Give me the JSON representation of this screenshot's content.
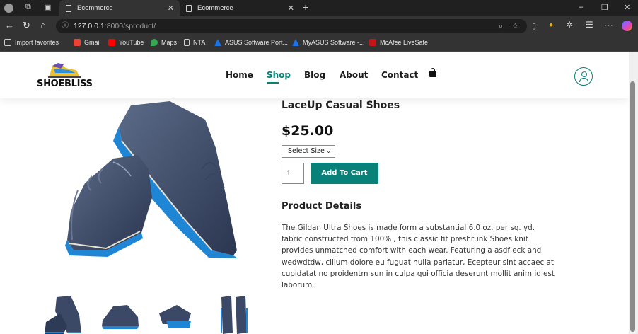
{
  "browser": {
    "tabs": [
      {
        "label": "Ecommerce"
      },
      {
        "label": "Ecommerce"
      }
    ],
    "url_host": "127.0.0.1",
    "url_rest": ":8000/sproduct/",
    "bookmarks": [
      {
        "label": "Import favorites",
        "color": "#cfcfcf"
      },
      {
        "label": "Gmail",
        "color": "#ea4335"
      },
      {
        "label": "YouTube",
        "color": "#ff0000"
      },
      {
        "label": "Maps",
        "color": "#34a853"
      },
      {
        "label": "NTA",
        "color": "#cfcfcf"
      },
      {
        "label": "ASUS Software Port...",
        "color": "#1a73e8"
      },
      {
        "label": "MyASUS Software -...",
        "color": "#1a73e8"
      },
      {
        "label": "McAfee LiveSafe",
        "color": "#c01818"
      }
    ]
  },
  "site": {
    "logo": "SHOEBLISS",
    "nav": [
      {
        "label": "Home"
      },
      {
        "label": "Shop"
      },
      {
        "label": "Blog"
      },
      {
        "label": "About"
      },
      {
        "label": "Contact"
      }
    ],
    "accent": "#088178"
  },
  "product": {
    "title": "LaceUp Casual Shoes",
    "price": "$25.00",
    "size_select": "Select Size",
    "quantity": "1",
    "add_to_cart": "Add To Cart",
    "details_heading": "Product Details",
    "description": "The Gildan Ultra Shoes is made form a substantial 6.0 oz. per sq. yd. fabric constructed from 100% , this classic fit preshrunk Shoes knit provides unmatched comfort with each wear. Featuring a asdf eck and wedwdtdw, cillum dolore eu fuguat nulla pariatur, Ecepteur sint accaec at cupidatat no proidentm sun in culpa qui officia deserunt mollit anim id est laborum.",
    "thumbnails": 4
  }
}
